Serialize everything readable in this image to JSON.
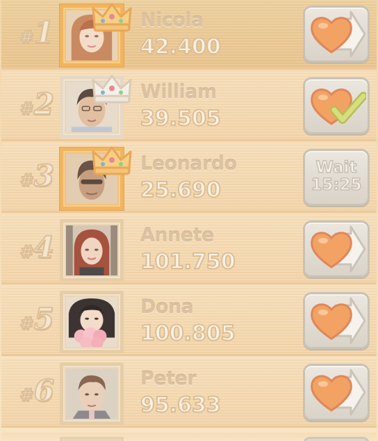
{
  "leaderboard": {
    "entries": [
      {
        "rank_prefix": "#",
        "rank": "1",
        "name": "Nicola",
        "score": "42.400",
        "action": "send-life",
        "crown": "gold"
      },
      {
        "rank_prefix": "#",
        "rank": "2",
        "name": "William",
        "score": "39.505",
        "action": "life-sent",
        "crown": "silver"
      },
      {
        "rank_prefix": "#",
        "rank": "3",
        "name": "Leonardo",
        "score": "25.690",
        "action": "wait",
        "crown": "gold",
        "wait_label": "Wait",
        "wait_time": "15:25"
      },
      {
        "rank_prefix": "#",
        "rank": "4",
        "name": "Annete",
        "score": "101.750",
        "action": "send-life"
      },
      {
        "rank_prefix": "#",
        "rank": "5",
        "name": "Dona",
        "score": "100.805",
        "action": "send-life"
      },
      {
        "rank_prefix": "#",
        "rank": "6",
        "name": "Peter",
        "score": "95.633",
        "action": "send-life"
      }
    ]
  },
  "icons": {
    "crown": "crown-icon",
    "send_life": "heart-arrow-icon",
    "life_sent": "heart-check-icon"
  },
  "colors": {
    "heart": "#f2a364",
    "check": "#c9d46a",
    "gold_frame": "#f1b460",
    "crown": "#f0ba66",
    "button_border": "#c9c2b6"
  }
}
